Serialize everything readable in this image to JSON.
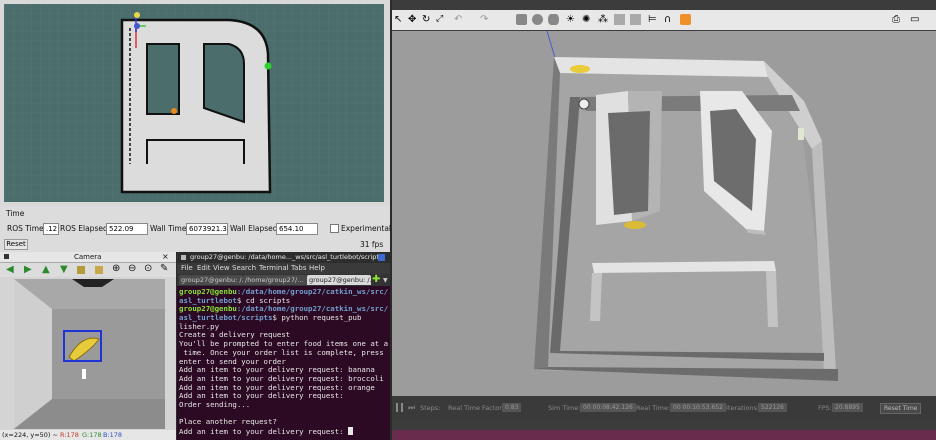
{
  "rviz": {
    "time_panel_title": "Time",
    "ros_time_label": "ROS Time:",
    "ros_time_value": ".12",
    "ros_elapsed_label": "ROS Elapsed:",
    "ros_elapsed_value": "522.09",
    "wall_time_label": "Wall Time:",
    "wall_time_value": "6073921.34",
    "wall_elapsed_label": "Wall Elapsed:",
    "wall_elapsed_value": "654.10",
    "experimental_label": "Experimental",
    "reset_label": "Reset",
    "fps": "31 fps"
  },
  "camera": {
    "title": "Camera",
    "status_coords": "(x=224, y=50) ~",
    "status_r": "R:178",
    "status_g": "G:178",
    "status_b": "B:178"
  },
  "terminal": {
    "title": "group27@genbu: /data/home..._ws/src/asl_turtlebot/scripts",
    "menu": [
      "File",
      "Edit",
      "View",
      "Search",
      "Terminal",
      "Tabs",
      "Help"
    ],
    "tabs": [
      "group27@genbu: /...",
      "/home/group27/...",
      "group27@genbu: /..."
    ],
    "lines": [
      {
        "p": "group27@genbu",
        "path": ":/data/home/group27/catkin_ws/src/",
        "t": ""
      },
      {
        "p": "",
        "path": "asl_turtlebot",
        "t": "$ cd scripts"
      },
      {
        "p": "group27@genbu",
        "path": ":/data/home/group27/catkin_ws/src/",
        "t": ""
      },
      {
        "p": "",
        "path": "asl_turtlebot/scripts",
        "t": "$ python request_pub"
      },
      {
        "p": "",
        "path": "",
        "t": "lisher.py"
      },
      {
        "p": "",
        "path": "",
        "t": "Create a delivery request"
      },
      {
        "p": "",
        "path": "",
        "t": "You'll be prompted to enter food items one at a"
      },
      {
        "p": "",
        "path": "",
        "t": " time. Once your order list is complete, press"
      },
      {
        "p": "",
        "path": "",
        "t": "enter to send your order"
      },
      {
        "p": "",
        "path": "",
        "t": "Add an item to your delivery request: banana"
      },
      {
        "p": "",
        "path": "",
        "t": "Add an item to your delivery request: broccoli"
      },
      {
        "p": "",
        "path": "",
        "t": "Add an item to your delivery request: orange"
      },
      {
        "p": "",
        "path": "",
        "t": "Add an item to your delivery request:"
      },
      {
        "p": "",
        "path": "",
        "t": "Order sending..."
      },
      {
        "p": "",
        "path": "",
        "t": ""
      },
      {
        "p": "",
        "path": "",
        "t": "Place another request?"
      },
      {
        "p": "",
        "path": "",
        "t": "Add an item to your delivery request: "
      }
    ]
  },
  "gazebo": {
    "steps_label": "Steps:",
    "rtf_label": "Real Time Factor:",
    "rtf_value": "0.83",
    "sim_time_label": "Sim Time:",
    "sim_time_value": "00 00:08:42.126",
    "real_time_label": "Real Time:",
    "real_time_value": "00 00:10:53.652",
    "iterations_label": "Iterations:",
    "iterations_value": "522126",
    "fps_label": "FPS:",
    "fps_value": "20.8895",
    "reset_time_label": "Reset Time"
  }
}
